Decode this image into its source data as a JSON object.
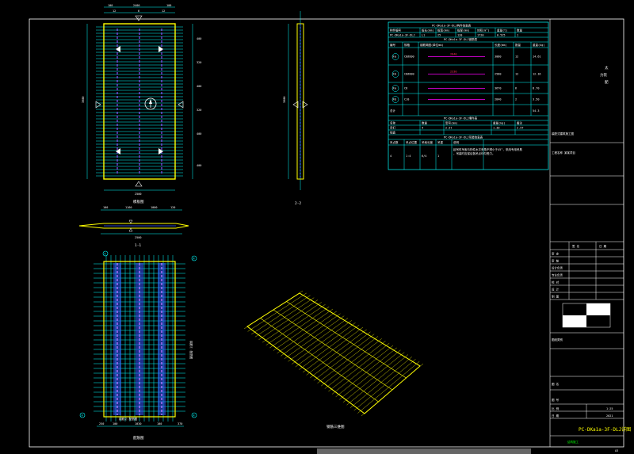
{
  "drawing": {
    "views": {
      "plan": {
        "title": "模板图",
        "top_dims": [
          "100",
          "2400",
          "100"
        ],
        "top_dims2": [
          "12",
          "6",
          "12"
        ],
        "bottom_dim": "2500",
        "left_dim": "3980",
        "right_dims": [
          "400",
          "320",
          "400",
          "320",
          "400",
          "400"
        ],
        "cut_label": "2"
      },
      "side": {
        "title": "2-2",
        "left_dim": "3980"
      },
      "section": {
        "title": "1-1",
        "top_dims": [
          "100",
          "1160",
          "1000",
          "120"
        ],
        "bottom_dim": "2500"
      },
      "rebar": {
        "title": "配筋图",
        "bottom_dims": [
          "250",
          "100",
          "1030",
          "100",
          "370"
        ],
        "axis_labels": [
          "①",
          "②",
          "③",
          "④"
        ],
        "inner_label": "钢筋②  配筋图",
        "right_label": "钢筋①    配筋图"
      },
      "iso": {
        "title": "钢筋三维图"
      }
    },
    "tables": {
      "concrete": {
        "title": "PC-DKa1a-3F-DLJ构件信息表",
        "header": [
          "构件编号",
          "板长(mm)",
          "板宽(mm)",
          "板厚(mm)",
          "体积(m³)",
          "重量(t)",
          "数量"
        ],
        "row": [
          "PC-DKa1a-3F-DLJ",
          "L1",
          "25",
          "120",
          "1720",
          "0.525",
          "1"
        ]
      },
      "rebar": {
        "title": "PC-DKa1a-3F-DLJ钢筋表",
        "header": [
          "编号",
          "规格",
          "钢筋简图(单位mm)",
          "长度(mm)",
          "数量",
          "重量(kg)"
        ],
        "rows": [
          {
            "id": "①a",
            "spec": "C8@200",
            "shape": "2840",
            "len": "3080",
            "qty": "12",
            "wt": "14.61"
          },
          {
            "id": "①b",
            "spec": "C8@200",
            "shape": "2330",
            "len": "2580",
            "qty": "12",
            "wt": "12.16"
          },
          {
            "id": "②a",
            "spec": "C8",
            "shape": "",
            "len": "3670",
            "qty": "6",
            "wt": "8.70"
          },
          {
            "id": "②b",
            "spec": "C10",
            "shape": "",
            "len": "2840",
            "qty": "2",
            "wt": "3.50"
          }
        ],
        "total_label": "总计",
        "total_value": "54.3"
      },
      "embed": {
        "title": "PC-DKa1a-3F-DLJ埋件表",
        "header": [
          "名称",
          "数量",
          "型号(mm)",
          "重量(kg)",
          "备注"
        ],
        "rows": [
          [
            "吊钉",
            "4",
            "2.5t",
            "1.30",
            "2.5T"
          ],
          [
            "线盒",
            "",
            "",
            "",
            ""
          ]
        ]
      },
      "lifting": {
        "title": "PC-DKa1a-3F-DLJ吊装信息表",
        "header": [
          "吊点数",
          "吊点位置",
          "吊索长度",
          "吊重",
          "说明"
        ],
        "rows": [
          [
            "4",
            "1:4",
            "6/4",
            "1",
            "起吊时吊索与构件水平夹角不得小于45°，采用专用吊具，吊装时应保证各吊点均匀受力。"
          ]
        ]
      }
    },
    "title_block": {
      "company": [
        "太",
        "力装",
        "配"
      ],
      "project_label": "工程名称",
      "project_value": "某某项目",
      "small_notes": [
        "装配式建筑施工图",
        "图纸类别"
      ],
      "rows": [
        "审 定",
        "审 核",
        "设计负责",
        "专业负责",
        "校 对",
        "设 计",
        "制 图"
      ],
      "cols": [
        "签 名",
        "日 期"
      ],
      "drawing_title_label": "图 名",
      "drawing_no_label": "图 号",
      "scale_label": "比 例",
      "scale_value": "1:25",
      "date_label": "日 期",
      "date_value": "2021",
      "sheet_code": "PC-DKa1a-3F-DLJ详图",
      "status": "结构施工"
    },
    "page_number": "A3"
  },
  "colors": {
    "background": "#000000",
    "frame": "#ffffff",
    "dim": "#00ffff",
    "outline": "#ffff00",
    "rebar": "#3355ff",
    "accent": "#ff00ff",
    "text": "#ffffff"
  }
}
